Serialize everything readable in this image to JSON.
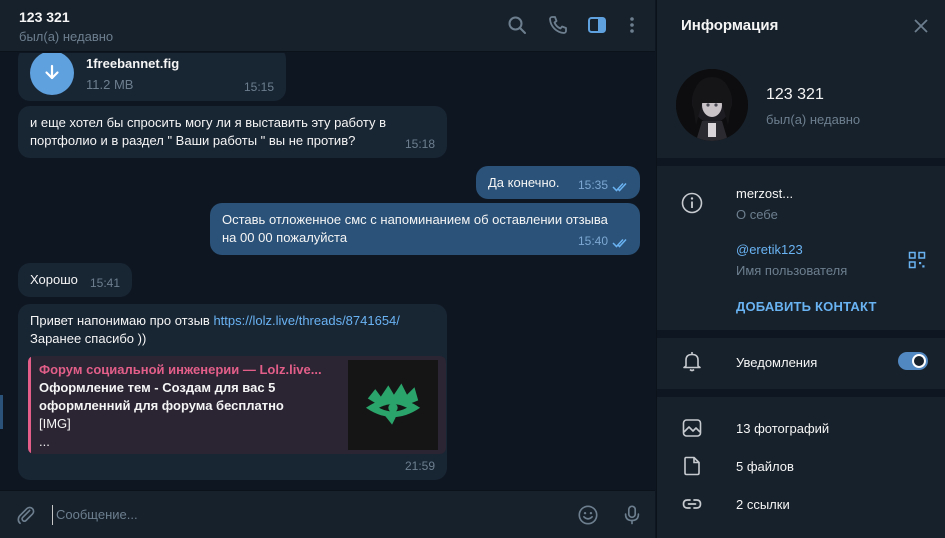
{
  "header": {
    "title": "123 321",
    "status": "был(а) недавно",
    "icons": [
      "search-icon",
      "phone-icon",
      "sidebar-toggle-icon",
      "more-icon"
    ]
  },
  "messages": {
    "file": {
      "name": "1freebannet.fig",
      "size": "11.2 MB",
      "time": "15:15"
    },
    "m1": {
      "line1": "и еще хотел бы спросить могу ли я выставить эту работу в",
      "line2": "портфолио и в раздел \" Ваши работы \" вы не против?",
      "time": "15:18"
    },
    "m2": {
      "text": "Да конечно.",
      "time": "15:35"
    },
    "m3": {
      "line1": "Оставь отложенное смс с напоминанием об оставлении отзыва",
      "line2": "на 00 00 пожалуйста",
      "time": "15:40"
    },
    "m4": {
      "text": "Хорошо",
      "time": "15:41"
    },
    "m5": {
      "prefix": "Привет напонимаю про отзыв ",
      "url": "https://lolz.live/threads/8741654/",
      "line2": "Заранее спасибо ))",
      "time": "21:59",
      "preview": {
        "site": "Форум социальной инженерии — Lolz.live...",
        "title": "Оформление тем - Создам для вас 5 оформленний для форума бесплатно",
        "extra1": "[IMG]",
        "extra2": "..."
      }
    }
  },
  "composer": {
    "placeholder": "Сообщение..."
  },
  "info": {
    "title": "Информация",
    "name": "123 321",
    "status": "был(а) недавно",
    "bio": "merzost...",
    "bio_label": "О себе",
    "username": "@eretik123",
    "username_label": "Имя пользователя",
    "add_contact": "ДОБАВИТЬ КОНТАКТ",
    "notifications": "Уведомления",
    "notifications_on": true,
    "photos": "13 фотографий",
    "files": "5 файлов",
    "links": "2 ссылки"
  },
  "colors": {
    "bg": "#0e1621",
    "panel": "#17212b",
    "incoming": "#182533",
    "outgoing": "#2b5278",
    "accent": "#6ab3f3",
    "preview_accent": "#e35f89"
  }
}
